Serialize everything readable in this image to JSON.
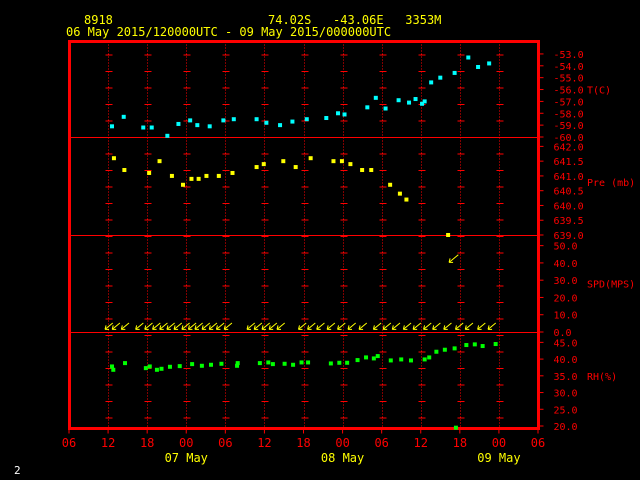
{
  "header": {
    "station_id": "8918",
    "location": "74.02S   -43.06E   3353M",
    "period": "06 May 2015/120000UTC - 09 May 2015/000000UTC"
  },
  "corner_label": "2",
  "colors": {
    "background": "#000000",
    "frame": "#ff0000",
    "grid": "#ff0000",
    "axis_text": "#ff0000",
    "header_text": "#ffff00",
    "date_text": "#ffff00",
    "temperature": "#00ffff",
    "pressure": "#ffff00",
    "wind": "#ffff00",
    "humidity": "#00ff00",
    "corner_text": "#ffffff"
  },
  "chart_data": {
    "type": "scatter",
    "x_axis": {
      "units": "hours since 06 May 2015 06 UTC",
      "range": [
        0,
        72
      ],
      "tick_labels": [
        "06",
        "12",
        "18",
        "00",
        "06",
        "12",
        "18",
        "00",
        "06",
        "12",
        "18",
        "00",
        "06"
      ],
      "date_labels": [
        {
          "text": "07 May",
          "at_tick": 3
        },
        {
          "text": "08 May",
          "at_tick": 7
        },
        {
          "text": "09 May",
          "at_tick": 11
        }
      ]
    },
    "panels": [
      {
        "name": "temperature",
        "label": "T(C)",
        "ylim": [
          -60,
          -52.5
        ],
        "tick_labels": [
          "-53.0",
          "-54.0",
          "-55.0",
          "-56.0",
          "-57.0",
          "-58.0",
          "-59.0",
          "-60.0"
        ],
        "tick_values": [
          -53,
          -54,
          -55,
          -56,
          -57,
          -58,
          -59,
          -60
        ],
        "label_value": -56.0,
        "color_key": "temperature",
        "points": [
          [
            6.6,
            -59.1
          ],
          [
            8.4,
            -58.3
          ],
          [
            11.4,
            -59.2
          ],
          [
            12.7,
            -59.2
          ],
          [
            15.1,
            -59.9
          ],
          [
            16.8,
            -58.9
          ],
          [
            18.6,
            -58.6
          ],
          [
            19.7,
            -59
          ],
          [
            21.6,
            -59.1
          ],
          [
            23.7,
            -58.6
          ],
          [
            25.3,
            -58.5
          ],
          [
            28.8,
            -58.5
          ],
          [
            30.3,
            -58.8
          ],
          [
            32.4,
            -59
          ],
          [
            34.3,
            -58.7
          ],
          [
            36.5,
            -58.5
          ],
          [
            39.5,
            -58.4
          ],
          [
            41.3,
            -58
          ],
          [
            42.3,
            -58.1
          ],
          [
            45.8,
            -57.5
          ],
          [
            47.1,
            -56.7
          ],
          [
            48.6,
            -57.6
          ],
          [
            50.6,
            -56.9
          ],
          [
            52.2,
            -57.1
          ],
          [
            53.2,
            -56.8
          ],
          [
            54.2,
            -57.2
          ],
          [
            54.6,
            -57
          ],
          [
            55.6,
            -55.4
          ],
          [
            57,
            -55
          ],
          [
            59.2,
            -54.6
          ],
          [
            61.3,
            -53.3
          ],
          [
            62.8,
            -54.1
          ],
          [
            64.5,
            -53.8
          ]
        ]
      },
      {
        "name": "pressure",
        "label": "Pre (mb)",
        "ylim": [
          639,
          642.25
        ],
        "tick_labels": [
          "642.0",
          "641.5",
          "641.0",
          "640.5",
          "640.0",
          "639.5",
          "639.0"
        ],
        "tick_values": [
          642,
          641.5,
          641,
          640.5,
          640,
          639.5,
          639
        ],
        "label_value": 640.8,
        "color_key": "pressure",
        "points": [
          [
            6.9,
            641.6
          ],
          [
            8.5,
            641.2
          ],
          [
            12.3,
            641.1
          ],
          [
            13.9,
            641.5
          ],
          [
            15.8,
            641
          ],
          [
            17.5,
            640.7
          ],
          [
            18.8,
            640.9
          ],
          [
            19.9,
            640.9
          ],
          [
            21.1,
            641
          ],
          [
            23,
            641
          ],
          [
            25.1,
            641.1
          ],
          [
            28.8,
            641.3
          ],
          [
            29.9,
            641.4
          ],
          [
            32.9,
            641.5
          ],
          [
            34.8,
            641.3
          ],
          [
            37.1,
            641.6
          ],
          [
            40.6,
            641.5
          ],
          [
            41.9,
            641.5
          ],
          [
            43.2,
            641.4
          ],
          [
            45,
            641.2
          ],
          [
            46.4,
            641.2
          ],
          [
            49.3,
            640.7
          ],
          [
            50.8,
            640.4
          ],
          [
            51.8,
            640.2
          ],
          [
            58.2,
            639
          ]
        ]
      },
      {
        "name": "wind",
        "label": "SPD(MPS)",
        "ylim": [
          0,
          55
        ],
        "tick_labels": [
          "50.0",
          "40.0",
          "30.0",
          "20.0",
          "10.0",
          "0.0"
        ],
        "tick_values": [
          50,
          40,
          30,
          20,
          10,
          0
        ],
        "label_value": 28.0,
        "color_key": "wind",
        "arrow_y_value": 3.5,
        "large_arrow": {
          "x": 59.0,
          "y": 43
        },
        "arrow_times": [
          6.1,
          7.2,
          8.6,
          10.8,
          12.2,
          13.4,
          14.5,
          15.6,
          16.7,
          17.9,
          18.9,
          19.9,
          21,
          22.1,
          23.2,
          24.4,
          27.9,
          29,
          30.2,
          31.3,
          32.5,
          35.8,
          37.2,
          38.6,
          40.2,
          41.8,
          43.4,
          45.1,
          47.3,
          48.8,
          50.2,
          51.9,
          53.4,
          55,
          56.4,
          58.1,
          59.9,
          61.4,
          63.3,
          64.9
        ]
      },
      {
        "name": "humidity",
        "label": "RH(%)",
        "ylim": [
          20,
          47.5
        ],
        "tick_labels": [
          "45.0",
          "40.0",
          "35.0",
          "30.0",
          "25.0",
          "20.0"
        ],
        "tick_values": [
          45,
          40,
          35,
          30,
          25,
          20
        ],
        "label_value": 35.0,
        "color_key": "humidity",
        "points": [
          [
            6.8,
            36.8
          ],
          [
            6.6,
            37.8
          ],
          [
            8.6,
            38.8
          ],
          [
            11.8,
            37.3
          ],
          [
            12.4,
            37.8
          ],
          [
            13.5,
            36.8
          ],
          [
            14.2,
            37.1
          ],
          [
            15.5,
            37.7
          ],
          [
            17,
            37.9
          ],
          [
            18.9,
            38.5
          ],
          [
            20.4,
            38
          ],
          [
            21.8,
            38.3
          ],
          [
            23.4,
            38.6
          ],
          [
            25.8,
            38
          ],
          [
            25.9,
            38.8
          ],
          [
            29.3,
            38.8
          ],
          [
            30.6,
            39
          ],
          [
            31.3,
            38.5
          ],
          [
            33.1,
            38.6
          ],
          [
            34.4,
            38.3
          ],
          [
            35.7,
            39
          ],
          [
            36.7,
            39
          ],
          [
            40.2,
            38.7
          ],
          [
            41.5,
            38.9
          ],
          [
            42.7,
            38.9
          ],
          [
            44.3,
            39.7
          ],
          [
            45.6,
            40.5
          ],
          [
            46.8,
            40.2
          ],
          [
            47.4,
            40.9
          ],
          [
            49.4,
            39.6
          ],
          [
            51,
            39.9
          ],
          [
            52.5,
            39.6
          ],
          [
            54.6,
            39.9
          ],
          [
            55.3,
            40.5
          ],
          [
            56.4,
            42.2
          ],
          [
            57.7,
            42.8
          ],
          [
            59.2,
            43.2
          ],
          [
            61,
            44.2
          ],
          [
            62.3,
            44.4
          ],
          [
            63.5,
            43.9
          ],
          [
            65.5,
            44.5
          ],
          [
            59.4,
            19.5
          ]
        ]
      }
    ]
  }
}
